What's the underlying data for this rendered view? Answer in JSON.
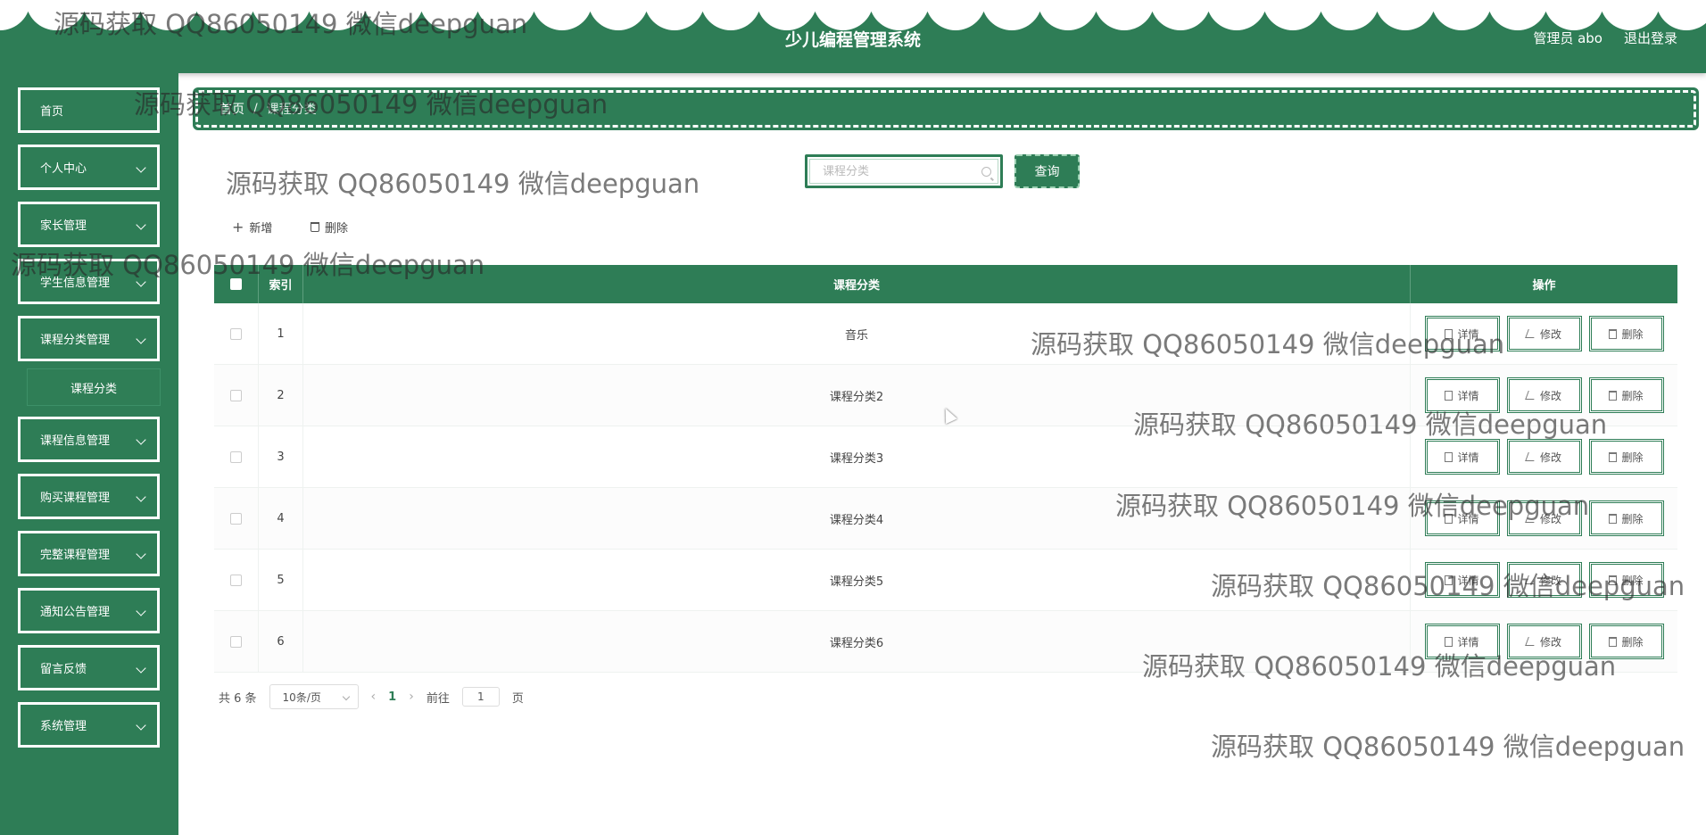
{
  "header": {
    "title": "少儿编程管理系统",
    "user_label": "管理员 abo",
    "logout_label": "退出登录"
  },
  "sidebar": {
    "items": [
      {
        "label": "首页",
        "has_children": false
      },
      {
        "label": "个人中心",
        "has_children": true
      },
      {
        "label": "家长管理",
        "has_children": true
      },
      {
        "label": "学生信息管理",
        "has_children": true
      },
      {
        "label": "课程分类管理",
        "has_children": true,
        "expanded": true
      },
      {
        "label": "课程信息管理",
        "has_children": true
      },
      {
        "label": "购买课程管理",
        "has_children": true
      },
      {
        "label": "完整课程管理",
        "has_children": true
      },
      {
        "label": "通知公告管理",
        "has_children": true
      },
      {
        "label": "留言反馈",
        "has_children": true
      },
      {
        "label": "系统管理",
        "has_children": true
      }
    ],
    "active_subitem": "课程分类"
  },
  "breadcrumb": {
    "home": "首页",
    "separator": "/",
    "current": "课程分类"
  },
  "search": {
    "placeholder": "课程分类",
    "value": "",
    "button_label": "查询"
  },
  "actions": {
    "add_label": "新增",
    "delete_label": "删除"
  },
  "table": {
    "columns": [
      "索引",
      "课程分类",
      "操作"
    ],
    "rows": [
      {
        "index": "1",
        "name": "音乐"
      },
      {
        "index": "2",
        "name": "课程分类2"
      },
      {
        "index": "3",
        "name": "课程分类3"
      },
      {
        "index": "4",
        "name": "课程分类4"
      },
      {
        "index": "5",
        "name": "课程分类5"
      },
      {
        "index": "6",
        "name": "课程分类6"
      }
    ],
    "row_actions": {
      "detail": "详情",
      "edit": "修改",
      "delete": "删除"
    }
  },
  "pagination": {
    "total_label": "共 6 条",
    "page_size_label": "10条/页",
    "current_page": "1",
    "goto_label": "前往",
    "goto_value": "1",
    "page_unit": "页"
  },
  "watermark": {
    "text": "源码获取 QQ86050149 微信deepguan"
  },
  "colors": {
    "primary": "#2e7d56",
    "header_text": "#ffffff"
  }
}
